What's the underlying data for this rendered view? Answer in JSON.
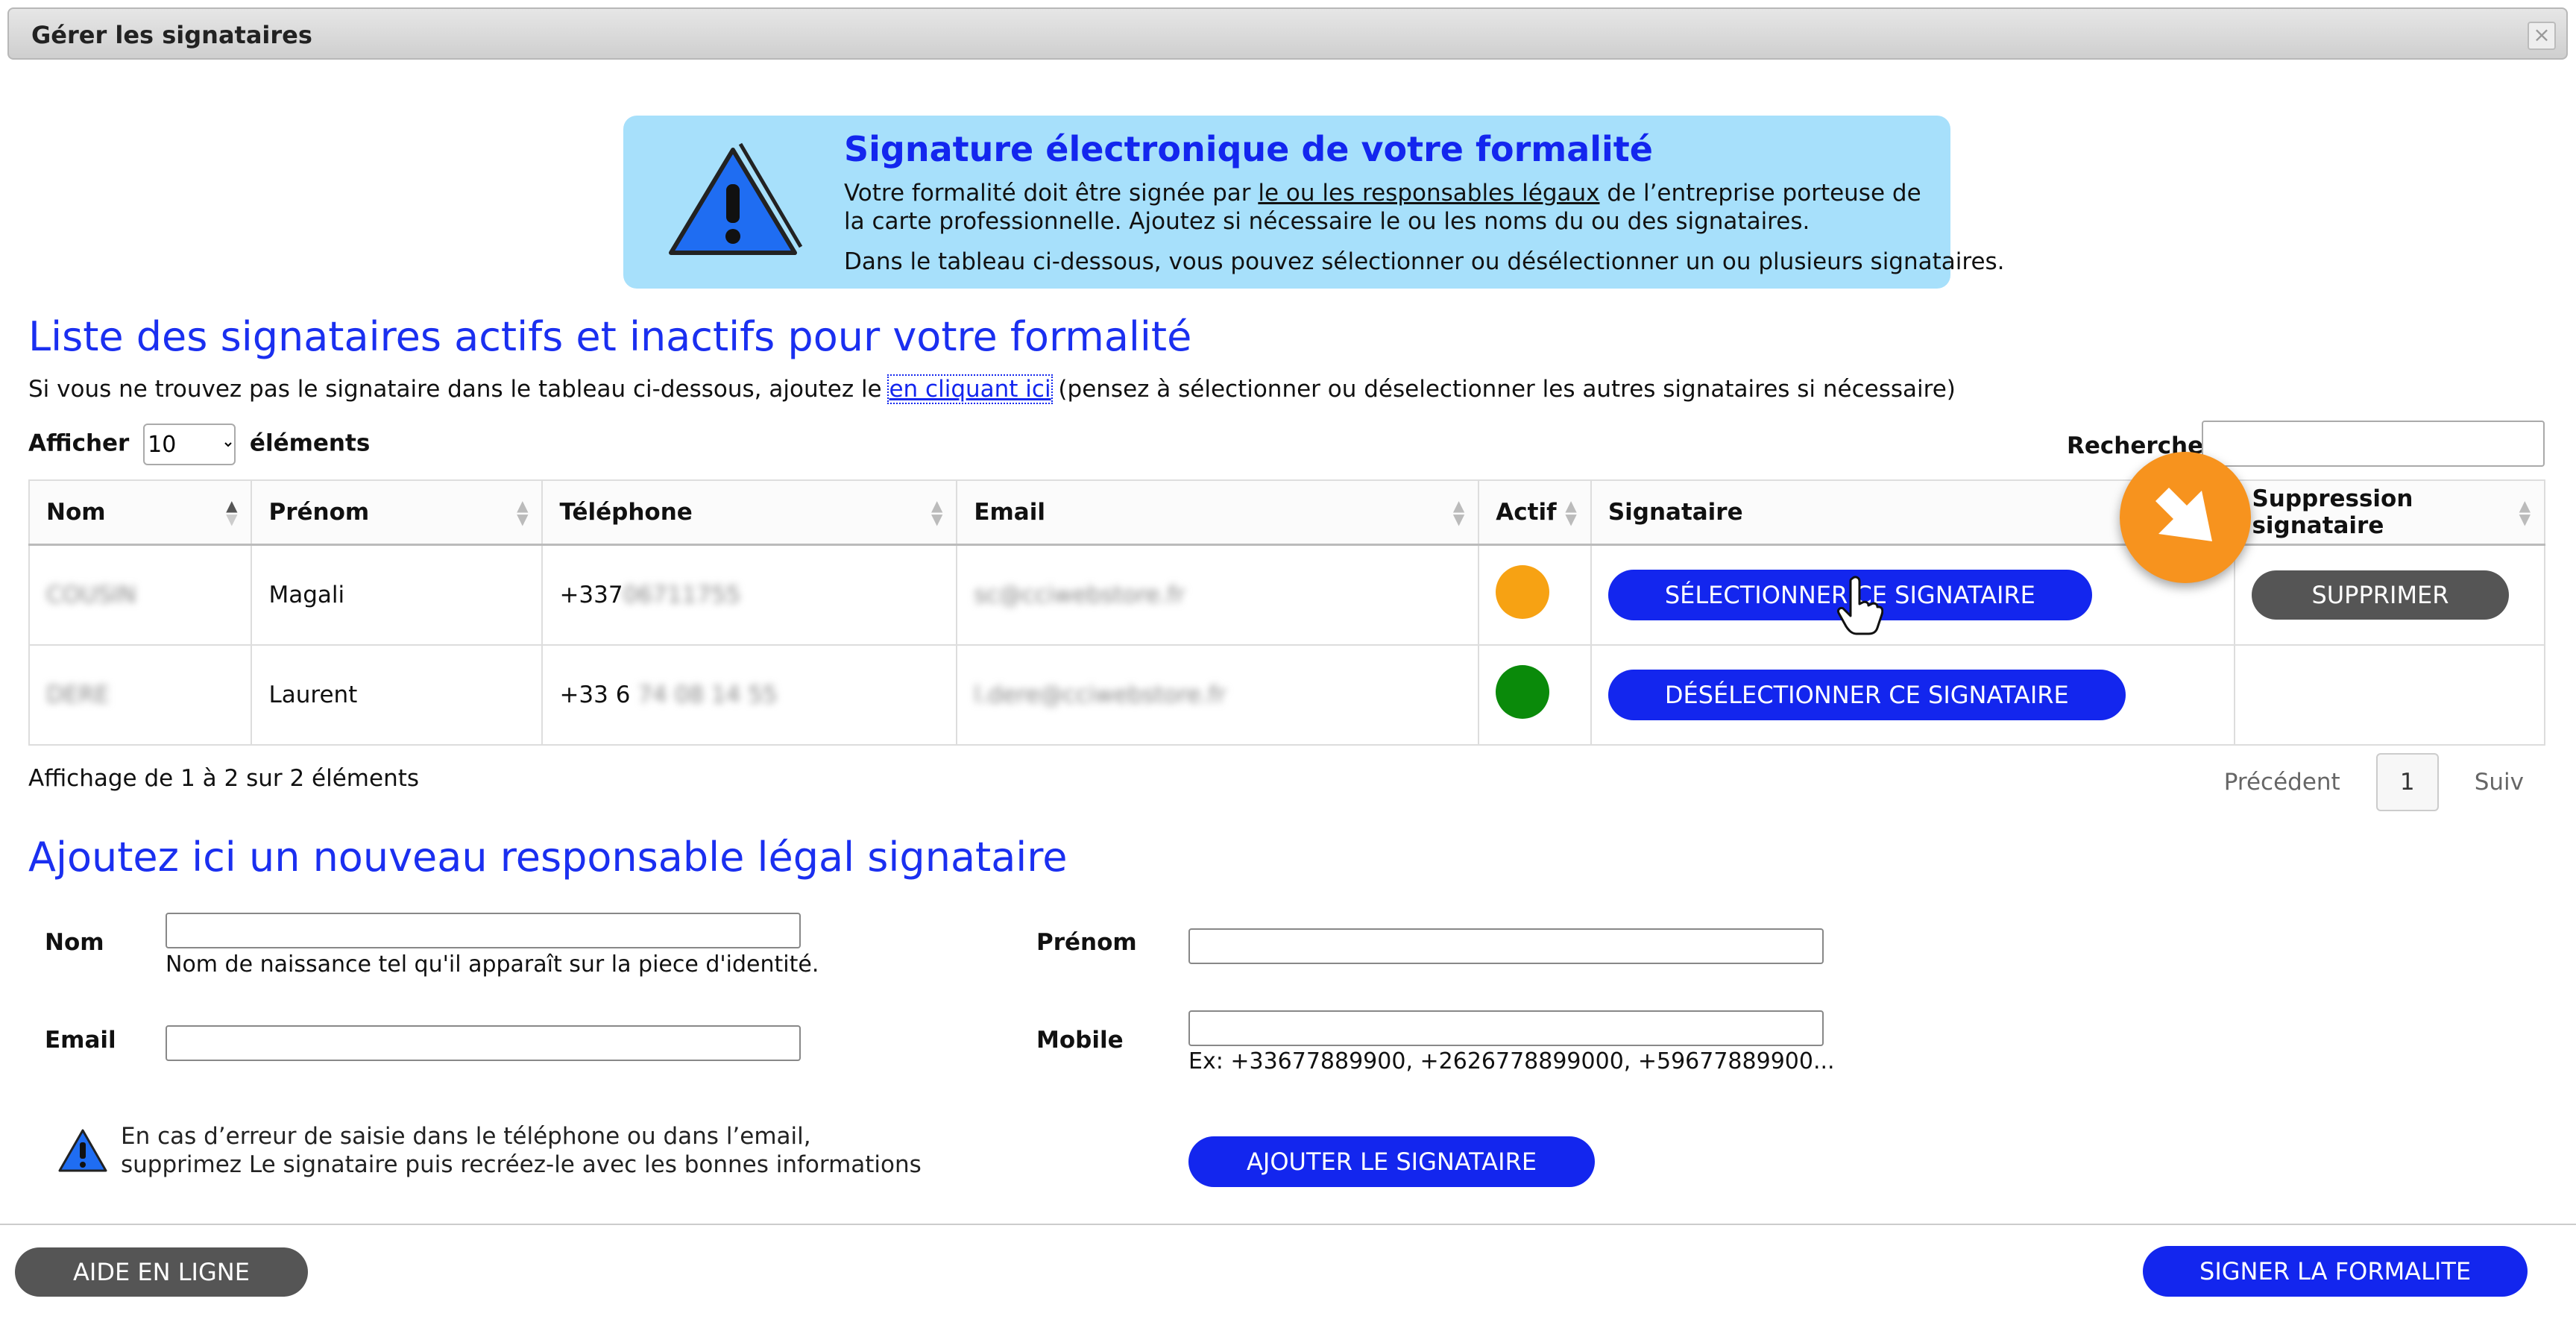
{
  "dialog": {
    "title": "Gérer les signataires",
    "close_glyph": "×"
  },
  "alert": {
    "title": "Signature électronique de votre formalité",
    "line1_prefix": "Votre formalité doit être signée par ",
    "line1_link": "le ou les responsables légaux",
    "line1_suffix": " de l’entreprise porteuse de",
    "line2": "la carte professionnelle. Ajoutez si nécessaire le ou les noms du ou des signataires.",
    "line3": "Dans le tableau ci-dessous, vous pouvez sélectionner ou désélectionner un ou plusieurs signataires."
  },
  "list": {
    "heading": "Liste des signataires actifs et inactifs pour votre formalité",
    "intro_prefix": "Si vous ne trouvez pas le signataire dans le tableau ci-dessous, ajoutez le ",
    "intro_link": "en cliquant ici",
    "intro_suffix": " (pensez à sélectionner ou déselectionner les autres signataires si nécessaire)",
    "length_label_before": "Afficher",
    "length_value": "10",
    "length_label_after": "éléments",
    "search_label": "Recherche:",
    "columns": [
      "Nom",
      "Prénom",
      "Téléphone",
      "Email",
      "Actif",
      "Signataire",
      "Suppression signataire"
    ],
    "rows": [
      {
        "nom": "COUSIN",
        "prenom": "Magali",
        "tel_visible": "+337",
        "tel_hidden": "06711755",
        "email": "sc@cciwebstore.fr",
        "status_color": "#f7a213",
        "action": "SÉLECTIONNER CE SIGNATAIRE",
        "delete": "SUPPRIMER"
      },
      {
        "nom": "DERE",
        "prenom": "Laurent",
        "tel_visible": "+33 6",
        "tel_hidden": "74 08 14 55",
        "email": "l.dere@cciwebstore.fr",
        "status_color": "#0a8a0a",
        "action": "DÉSÉLECTIONNER CE SIGNATAIRE",
        "delete": ""
      }
    ],
    "info": "Affichage de 1 à 2 sur 2 éléments",
    "pager": {
      "prev": "Précédent",
      "page": "1",
      "next": "Suiv"
    }
  },
  "form": {
    "heading": "Ajoutez ici un nouveau responsable légal signataire",
    "nom_label": "Nom",
    "nom_hint": "Nom de naissance tel qu'il apparaît sur la piece d'identité.",
    "prenom_label": "Prénom",
    "email_label": "Email",
    "mobile_label": "Mobile",
    "mobile_hint": "Ex: +33677889900, +2626778899000, +59677889900...",
    "warning_line1": "En cas d’erreur de saisie dans le téléphone ou dans l’email,",
    "warning_line2": "supprimez Le signataire puis recréez-le avec les bonnes informations",
    "add_button": "AJOUTER LE SIGNATAIRE"
  },
  "footer": {
    "help_button": "AIDE EN LIGNE",
    "sign_button": "SIGNER LA FORMALITE"
  },
  "colors": {
    "accent": "#1326ee",
    "alert_bg": "#a7e0fb",
    "cursor_badge": "#f7931e"
  },
  "icons": [
    "warning-triangle-icon",
    "sort-icon",
    "hand-pointer-icon",
    "arrow-cursor-icon",
    "close-icon"
  ]
}
